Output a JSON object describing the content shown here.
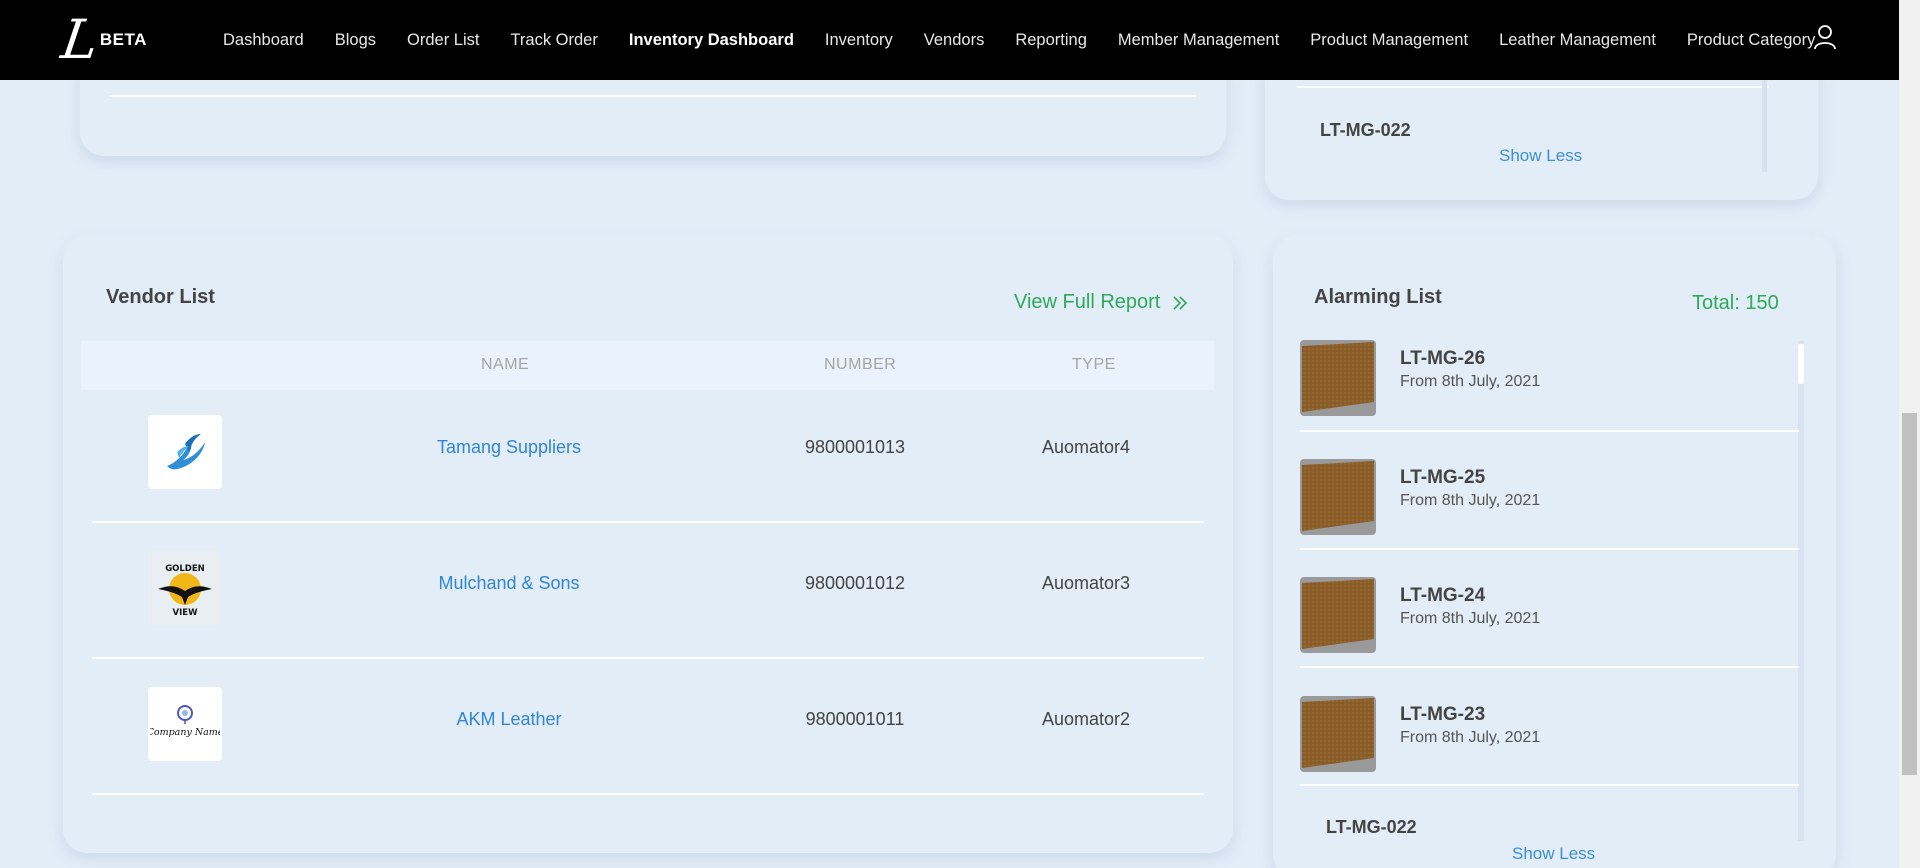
{
  "brand": {
    "beta": "BETA"
  },
  "nav": {
    "items": [
      {
        "label": "Dashboard",
        "active": false
      },
      {
        "label": "Blogs",
        "active": false
      },
      {
        "label": "Order List",
        "active": false
      },
      {
        "label": "Track Order",
        "active": false
      },
      {
        "label": "Inventory Dashboard",
        "active": true
      },
      {
        "label": "Inventory",
        "active": false
      },
      {
        "label": "Vendors",
        "active": false
      },
      {
        "label": "Reporting",
        "active": false
      },
      {
        "label": "Member Management",
        "active": false
      },
      {
        "label": "Product Management",
        "active": false
      },
      {
        "label": "Leather Management",
        "active": false
      },
      {
        "label": "Product Category",
        "active": false
      }
    ],
    "user_icon": "user-icon"
  },
  "top_right": {
    "code": "LT-MG-022",
    "show_less": "Show Less"
  },
  "vendor_list": {
    "title": "Vendor List",
    "view_full_report": "View Full Report",
    "columns": {
      "name": "NAME",
      "number": "NUMBER",
      "type": "TYPE"
    },
    "rows": [
      {
        "name": "Tamang Suppliers",
        "number": "9800001013",
        "type": "Auomator4",
        "logo": "blue-bird-logo"
      },
      {
        "name": "Mulchand & Sons",
        "number": "9800001012",
        "type": "Auomator3",
        "logo": "golden-view-logo"
      },
      {
        "name": "AKM Leather",
        "number": "9800001011",
        "type": "Auomator2",
        "logo": "company-name-logo"
      }
    ],
    "logo_text": {
      "golden_top": "GOLDEN",
      "golden_bottom": "VIEW",
      "company": "Company Name"
    }
  },
  "alarming_list": {
    "title": "Alarming List",
    "total": "Total: 150",
    "items": [
      {
        "code": "LT-MG-26",
        "date": "From 8th July, 2021"
      },
      {
        "code": "LT-MG-25",
        "date": "From 8th July, 2021"
      },
      {
        "code": "LT-MG-24",
        "date": "From 8th July, 2021"
      },
      {
        "code": "LT-MG-23",
        "date": "From 8th July, 2021"
      }
    ],
    "last_code": "LT-MG-022",
    "show_less": "Show Less"
  },
  "colors": {
    "accent_green": "#2eaa5a",
    "link_blue": "#2f86d4",
    "background": "#e3edf8",
    "nav_bg": "#000000"
  }
}
